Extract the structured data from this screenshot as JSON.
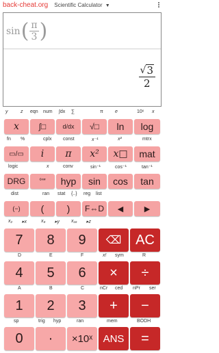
{
  "topbar": {
    "back_text": "back-cheat.org",
    "title": "Scientific Calculator",
    "caret": "▼"
  },
  "display": {
    "expr": {
      "fn": "sin",
      "open": "(",
      "num": "π",
      "den": "3",
      "close": ")"
    },
    "result": {
      "root": "√",
      "radicand": "3",
      "den": "2"
    }
  },
  "row1_labels": [
    "y",
    "z",
    "eqn",
    "num",
    "∫dx",
    "∑",
    "π",
    "e",
    "10ˣ",
    "x"
  ],
  "row1_keys": [
    "x",
    "∫□",
    "d/dx",
    "√□",
    "ln",
    "log"
  ],
  "row2_labels": [
    "fn",
    "%",
    "cplx",
    "const",
    "x⁻¹",
    "x²",
    "mtrx"
  ],
  "row2_keys": [
    "▭/▭",
    "i",
    "π",
    "x²",
    "x□",
    "mat"
  ],
  "row3_labels": [
    "logic",
    "x",
    "conv",
    "sin⁻¹",
    "cos⁻¹",
    "tan⁻¹"
  ],
  "row3_keys": [
    "DRG",
    "°′″",
    "hyp",
    "sin",
    "cos",
    "tan"
  ],
  "row4_labels": [
    "dist",
    "ran",
    "stat",
    "{..}",
    "reg",
    "list"
  ],
  "row4_keys": [
    "(−)",
    "(",
    ")",
    "F⇔D",
    "◀",
    "▶"
  ],
  "row5_labels": [
    "x₂",
    "▸x",
    "x₈",
    "▸y",
    "x₁₆",
    "▸z"
  ],
  "num_row1": [
    "7",
    "8",
    "9",
    "⌫",
    "AC"
  ],
  "num_row1_labels": [
    "D",
    "E",
    "F",
    "x!",
    "sym",
    "R"
  ],
  "num_row2": [
    "4",
    "5",
    "6",
    "×",
    "÷"
  ],
  "num_row2_labels": [
    "A",
    "B",
    "C",
    "nCr",
    "ced",
    "nPr",
    "ser"
  ],
  "num_row3": [
    "1",
    "2",
    "3",
    "+",
    "−"
  ],
  "num_row3_labels": [
    "sp",
    "trig",
    "hyp",
    "ran",
    "mem",
    "BODH"
  ],
  "num_row4": [
    "0",
    "·",
    "×10ˣ",
    "ANS",
    "="
  ]
}
